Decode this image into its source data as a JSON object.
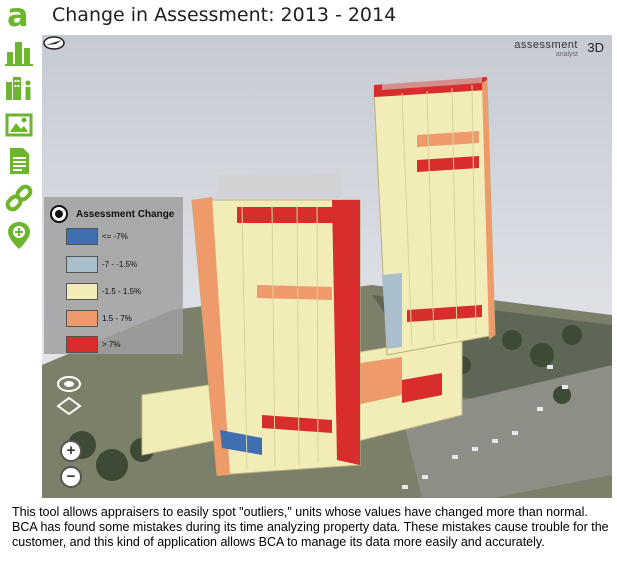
{
  "page": {
    "title": "Change in Assessment: 2013 - 2014",
    "caption": "This tool allows appraisers to easily spot \"outliers,\" units whose values have changed more than normal. BCA has found some mistakes during its time analyzing property data. These mistakes cause trouble for the customer, and this kind of application allows BCA to manage its data more easily and accurately."
  },
  "sidebar": {
    "accent_color": "#6cb52d",
    "items": [
      {
        "icon": "app-logo-a-icon",
        "glyph": "a"
      },
      {
        "icon": "buildings-chart-icon"
      },
      {
        "icon": "building-info-icon"
      },
      {
        "icon": "image-icon"
      },
      {
        "icon": "document-icon"
      },
      {
        "icon": "link-icon"
      },
      {
        "icon": "location-add-icon"
      }
    ]
  },
  "viewer": {
    "brand_line1": "assessment",
    "brand_line2": "analyst",
    "brand_badge": "3D"
  },
  "legend": {
    "title": "Assessment Change",
    "items": [
      {
        "label": "<= -7%",
        "color": "#3f6fb0"
      },
      {
        "label": "-7 - -1.5%",
        "color": "#a9bfcc"
      },
      {
        "label": "-1.5 - 1.5%",
        "color": "#f2edb8"
      },
      {
        "label": "1.5 - 7%",
        "color": "#ee9a6a"
      },
      {
        "label": "> 7%",
        "color": "#d92d2d"
      }
    ]
  },
  "controls": {
    "zoom_in": "+",
    "zoom_out": "−"
  }
}
